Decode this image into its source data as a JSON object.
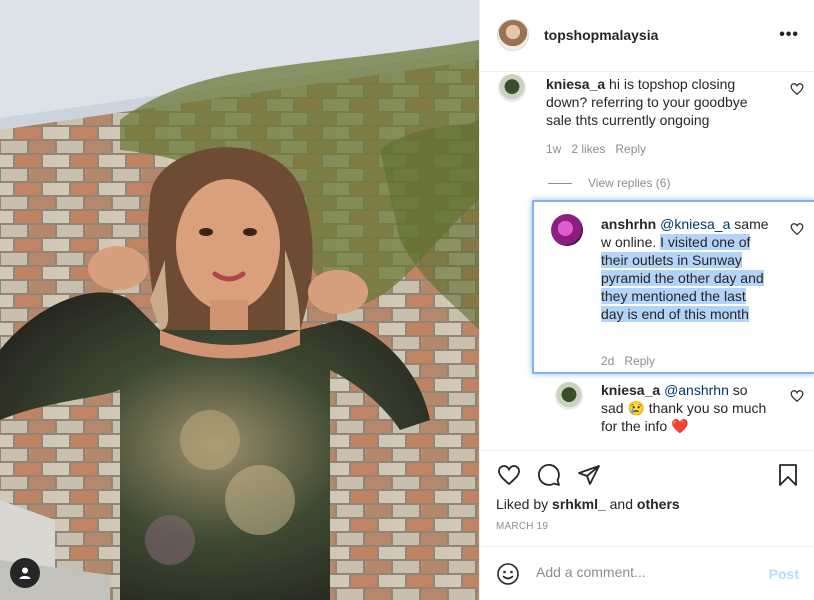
{
  "post": {
    "username": "topshopmalaysia",
    "more_label": "•••"
  },
  "comments": [
    {
      "username": "kniesa_a",
      "text": " hi is topshop closing down? referring to your goodbye sale thts currently ongoing",
      "time": "1w",
      "likes": "2 likes",
      "reply_label": "Reply",
      "view_replies": "View replies (6)"
    }
  ],
  "replies": [
    {
      "username": "anshrhn",
      "mention": "@kniesa_a",
      "text_plain": " same w online. ",
      "text_highlight": "I visited one of their outlets in Sunway pyramid the other day and they mentioned the last day is end of this month",
      "time": "2d",
      "reply_label": "Reply"
    },
    {
      "username": "kniesa_a",
      "mention": "@anshrhn",
      "text": " so sad 😢 thank you so much for the info ❤️"
    }
  ],
  "footer": {
    "liked_prefix": "Liked by ",
    "liked_user": "srhkml_",
    "liked_suffix": " and ",
    "liked_others": "others",
    "date": "MARCH 19",
    "comment_placeholder": "Add a comment...",
    "post_label": "Post"
  },
  "icons": [
    "user-tag-icon",
    "more-icon",
    "heart-icon",
    "comment-icon",
    "share-icon",
    "bookmark-icon",
    "emoji-icon"
  ],
  "colors": {
    "text": "#262626",
    "muted": "#8e8e8e",
    "mention": "#00376b",
    "post_disabled": "#b2dffc",
    "selection": "#b4d3f8",
    "focus_border": "#7fb2f0"
  }
}
